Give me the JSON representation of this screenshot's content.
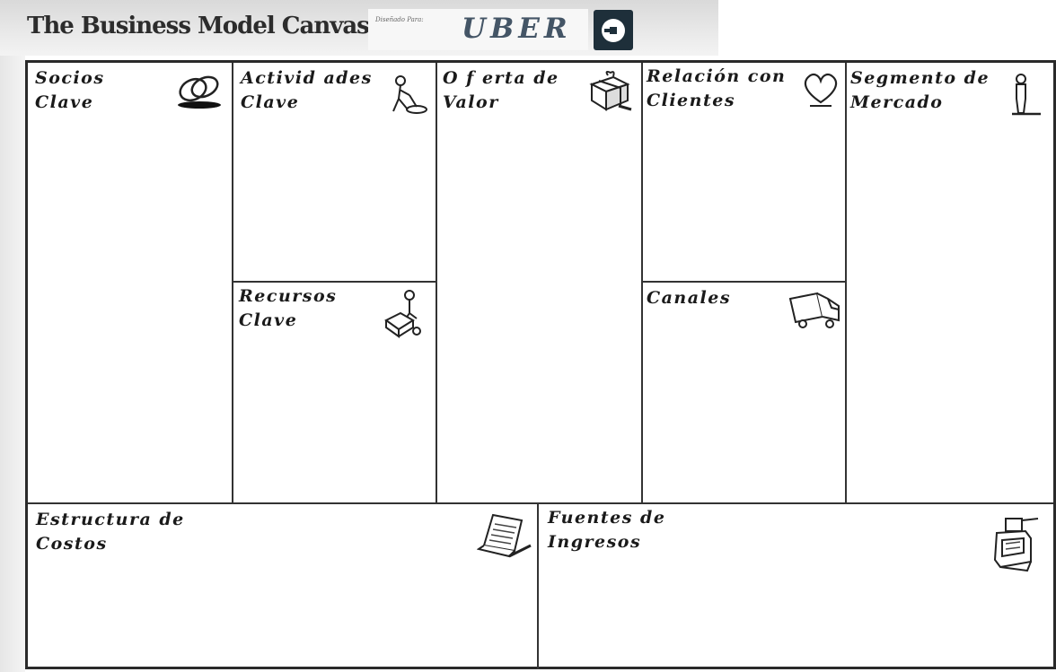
{
  "header": {
    "title": "The Business Model Canvas",
    "designed_for_label": "Diseñado Para:",
    "company": "UBER",
    "logo_icon": "uber-logo-icon"
  },
  "blocks": {
    "key_partners": {
      "label": "Socios\nClave",
      "icon": "chain-links-icon"
    },
    "key_activities": {
      "label": "Activid ades\nClave",
      "icon": "worker-icon"
    },
    "value_proposition": {
      "label": "O f erta de\nValor",
      "icon": "gift-icon"
    },
    "customer_relationships": {
      "label": "Relación con\nClientes",
      "icon": "heart-icon"
    },
    "customer_segments": {
      "label": "Segmento de\nMercado",
      "icon": "person-icon"
    },
    "key_resources": {
      "label": "Recursos\nClave",
      "icon": "worker-with-box-icon"
    },
    "channels": {
      "label": "Canales",
      "icon": "truck-icon"
    },
    "cost_structure": {
      "label": "Estructura de\nCostos",
      "icon": "receipt-icon"
    },
    "revenue_streams": {
      "label": "Fuentes de\nIngresos",
      "icon": "cash-register-icon"
    }
  },
  "colors": {
    "logo_bg": "#1e2f3a",
    "company_text": "#445566",
    "border": "#2a2a2a"
  }
}
